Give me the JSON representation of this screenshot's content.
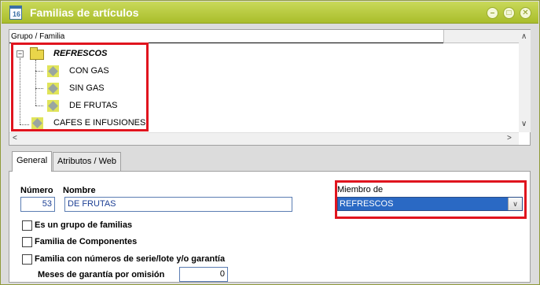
{
  "window": {
    "title": "Familias de artículos",
    "icon": "calendar-16-icon",
    "icon_text": "16",
    "accent_color": "#b5c834",
    "controls": [
      "minimize-icon",
      "maximize-icon",
      "close-icon"
    ],
    "control_glyphs": {
      "minimize": "–",
      "maximize": "□",
      "close": "✕"
    }
  },
  "tree": {
    "header": "Grupo / Familia",
    "expander_glyph": "−",
    "root": {
      "label": "REFRESCOS",
      "expanded": true,
      "icon": "folder-open-icon"
    },
    "children": [
      {
        "label": "CON GAS",
        "icon": "family-icon"
      },
      {
        "label": "SIN GAS",
        "icon": "family-icon"
      },
      {
        "label": "DE FRUTAS",
        "icon": "family-icon"
      }
    ],
    "sibling": {
      "label": "CAFES E INFUSIONES",
      "icon": "family-icon"
    },
    "scroll_glyphs": {
      "up": "∧",
      "down": "∨",
      "left": "<",
      "right": ">"
    }
  },
  "tabs": [
    {
      "label": "General",
      "active": true
    },
    {
      "label": "Atributos / Web",
      "active": false
    }
  ],
  "form": {
    "numero_label": "Número",
    "numero_value": "53",
    "nombre_label": "Nombre",
    "nombre_value": "DE FRUTAS",
    "miembro_label": "Miembro de",
    "miembro_value": "REFRESCOS",
    "dropdown_glyph": "∨",
    "checkbox_grupo": "Es un grupo de familias",
    "checkbox_componentes": "Familia de Componentes",
    "checkbox_serie": "Familia con números de serie/lote y/o garantía",
    "meses_label": "Meses de garantía por omisión",
    "meses_value": "0"
  },
  "highlight_color": "#e0141e"
}
